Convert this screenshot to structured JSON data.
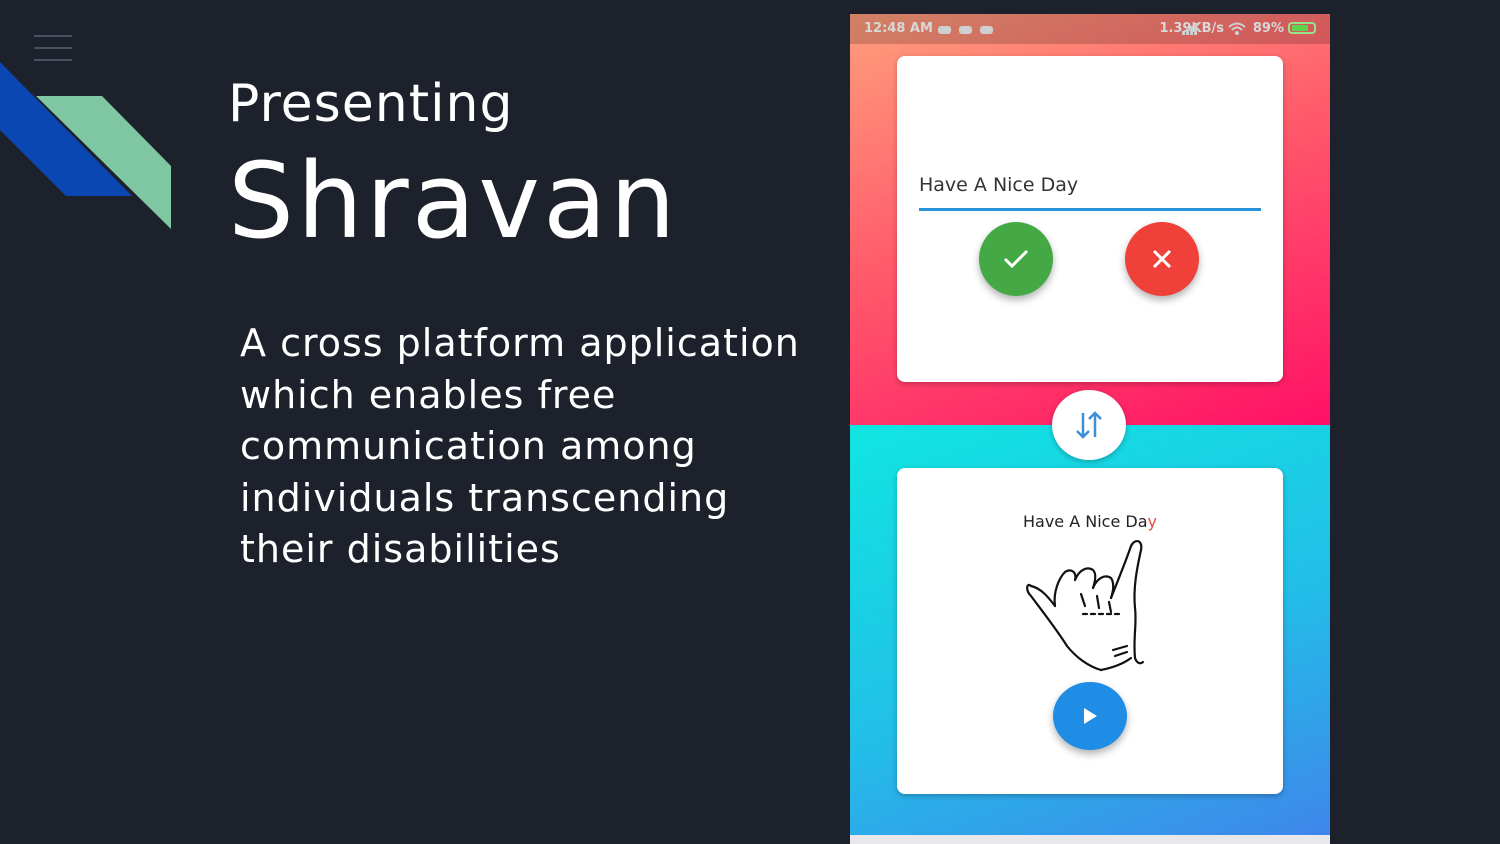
{
  "slide": {
    "kicker": "Presenting",
    "title": "Shravan",
    "description": "A cross platform application which enables free communication among individuals transcending their disabilities"
  },
  "phone": {
    "status_bar": {
      "time": "12:48 AM",
      "network_speed": "1.39KB/s",
      "battery": "89%"
    },
    "input_card": {
      "text_value": "Have A Nice Day",
      "confirm_icon": "check-icon",
      "cancel_icon": "close-icon"
    },
    "swap_icon": "swap-arrows-icon",
    "output_card": {
      "text_main": "Have A Nice Da",
      "text_last": "y",
      "image": "hand-sign-image",
      "play_icon": "play-icon"
    },
    "colors": {
      "confirm": "#44a844",
      "cancel": "#f0403a",
      "play": "#1f8ce6",
      "underline": "#2a92d8"
    }
  }
}
